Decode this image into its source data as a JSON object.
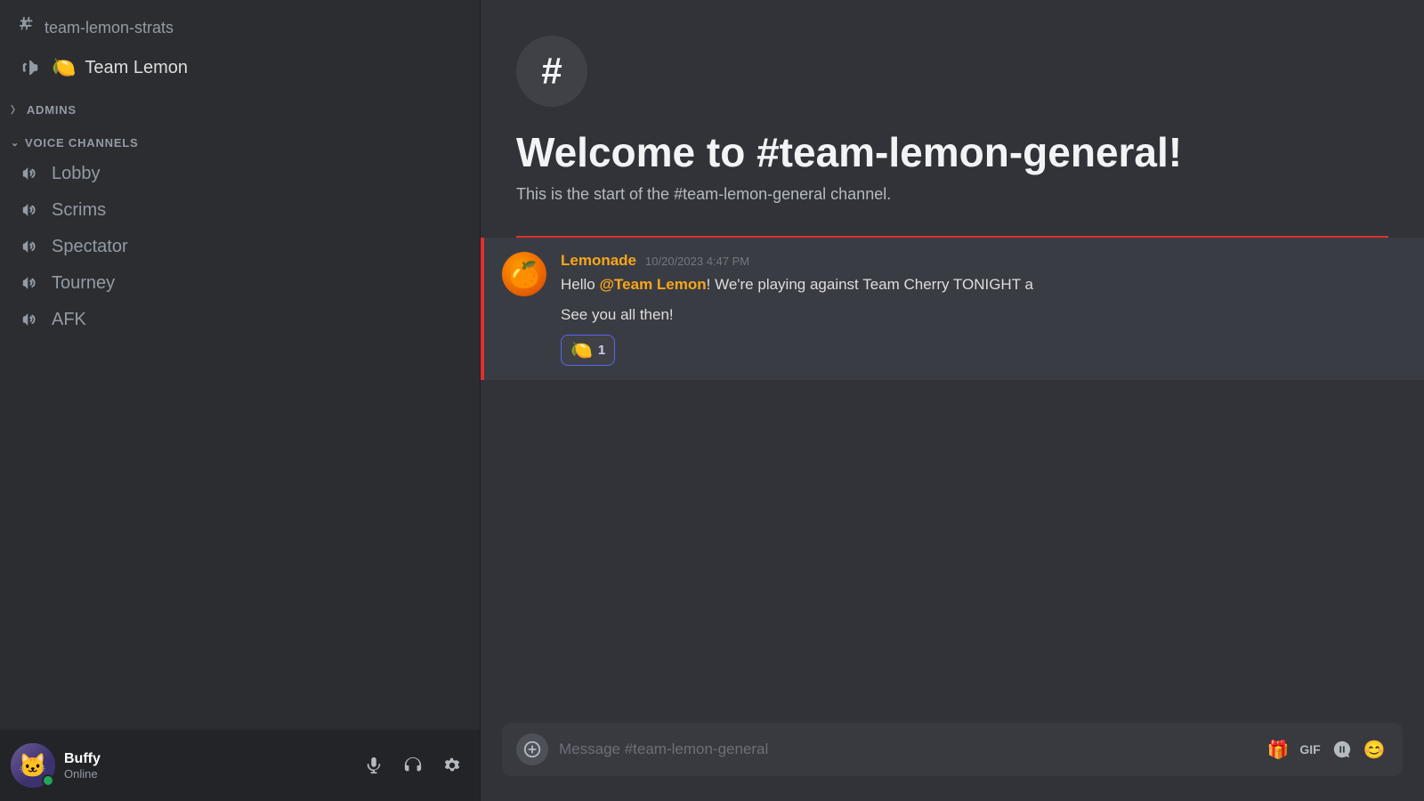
{
  "sidebar": {
    "strats_channel": "team-lemon-strats",
    "team_lemon_voice": "Team Lemon",
    "team_lemon_emoji": "🍋",
    "admins_section": "ADMINS",
    "voice_channels_section": "VOICE CHANNELS",
    "voice_channels": [
      {
        "name": "Lobby"
      },
      {
        "name": "Scrims"
      },
      {
        "name": "Spectator"
      },
      {
        "name": "Tourney"
      },
      {
        "name": "AFK"
      }
    ]
  },
  "user_bar": {
    "username": "Buffy",
    "status": "Online"
  },
  "main": {
    "welcome_icon": "#",
    "welcome_title": "Welcome to #team-lemon-general!",
    "welcome_desc": "This is the start of the #team-lemon-general channel.",
    "message_input_placeholder": "Message #team-lemon-general"
  },
  "messages": [
    {
      "id": "msg1",
      "username": "Lemonade",
      "timestamp": "10/20/2023 4:47 PM",
      "text_before_mention": "Hello ",
      "mention": "@Team Lemon",
      "text_after_mention": "! We're playing against Team Cherry TONIGHT a",
      "text_line2": "See you all then!",
      "reaction_emoji": "🍋",
      "reaction_count": "1"
    }
  ],
  "icons": {
    "hash": "#",
    "microphone": "🎤",
    "headphones": "🎧",
    "settings": "⚙",
    "add": "+",
    "emoji": "🙂",
    "gift": "🎁"
  },
  "colors": {
    "accent": "#5865f2",
    "online": "#23a55a",
    "lemonade_color": "#faa61a",
    "red_divider": "#e03030",
    "mention_color": "#c9cdfb"
  }
}
